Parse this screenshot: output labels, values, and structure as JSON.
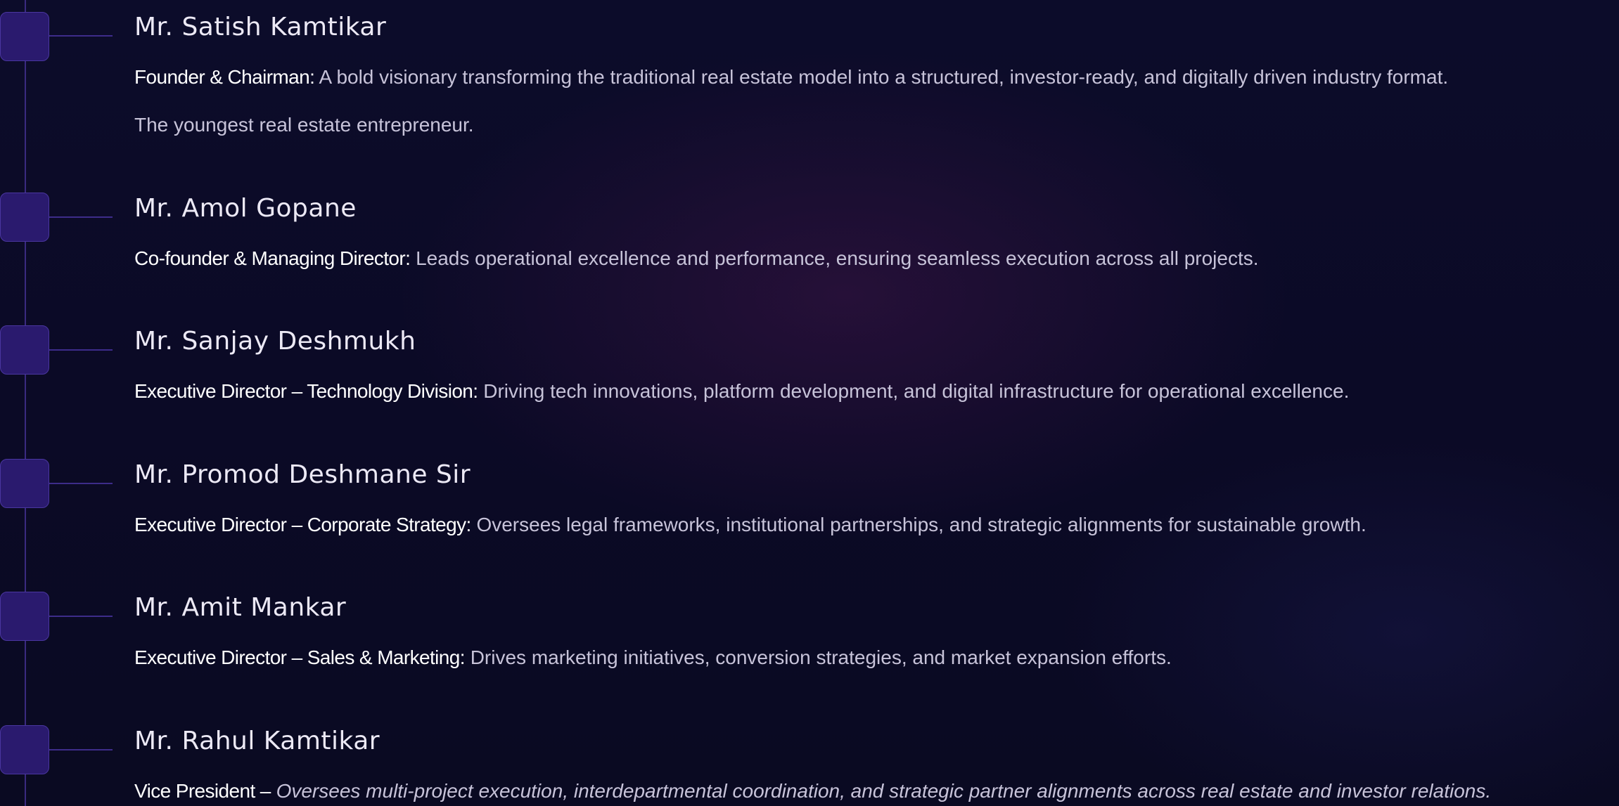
{
  "leaders": [
    {
      "name": "Mr. Satish Kamtikar",
      "role": "Founder & Chairman:",
      "description": "A bold visionary transforming the traditional real estate model into a structured, investor-ready, and digitally driven industry format.",
      "extra": "The youngest real estate entrepreneur."
    },
    {
      "name": "Mr. Amol Gopane",
      "role": "Co-founder & Managing Director:",
      "description": "Leads operational excellence and performance, ensuring seamless execution across all projects."
    },
    {
      "name": "Mr. Sanjay Deshmukh",
      "role": "Executive Director –  Technology Division:",
      "description": "Driving tech innovations, platform development, and digital infrastructure for operational excellence."
    },
    {
      "name": "Mr. Promod Deshmane Sir",
      "role": "Executive Director –  Corporate Strategy:",
      "description": "Oversees legal frameworks, institutional partnerships, and strategic alignments for sustainable growth."
    },
    {
      "name": "Mr. Amit Mankar",
      "role": "Executive Director –  Sales & Marketing:",
      "description": "Drives marketing initiatives, conversion strategies, and market expansion efforts."
    },
    {
      "name": "Mr. Rahul Kamtikar",
      "role": "Vice President –",
      "description": "Oversees multi-project execution, interdepartmental coordination, and strategic partner alignments across real estate and investor relations."
    }
  ]
}
